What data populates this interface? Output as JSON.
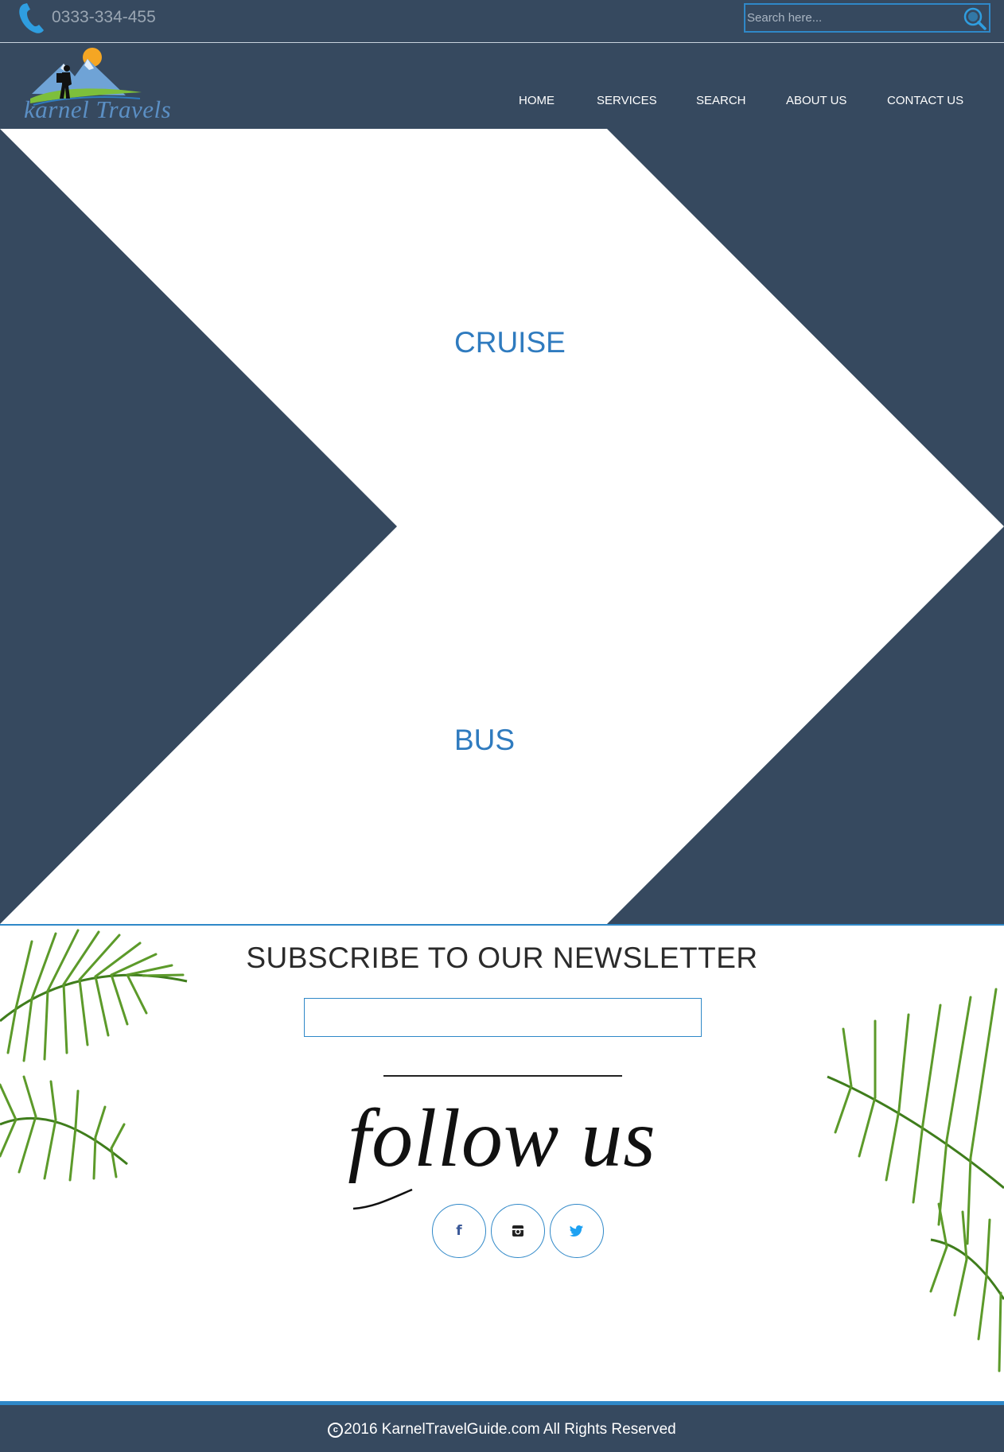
{
  "topbar": {
    "phone": "0333-334-455",
    "phone_icon": "phone-icon",
    "search_placeholder": "Search here...",
    "search_icon": "globe-search-icon"
  },
  "brand": {
    "logo_text": "karnel Travels"
  },
  "nav": {
    "items": [
      {
        "label": "HOME"
      },
      {
        "label": "SERVICES"
      },
      {
        "label": "SEARCH"
      },
      {
        "label": "ABOUT US"
      },
      {
        "label": "CONTACT US"
      }
    ]
  },
  "hero": {
    "labels": [
      "CRUISE",
      "BUS"
    ]
  },
  "newsletter": {
    "title": "SUBSCRIBE TO OUR NEWSLETTER",
    "input_value": ""
  },
  "follow": {
    "title": "follow us",
    "social": [
      {
        "icon": "facebook-icon",
        "glyph": "f"
      },
      {
        "icon": "instagram-icon"
      },
      {
        "icon": "twitter-icon"
      }
    ]
  },
  "footer": {
    "copy_symbol": "c",
    "text": "2016 KarnelTravelGuide.com All Rights Reserved"
  },
  "colors": {
    "navy": "#36495f",
    "accent_blue": "#2f88c8",
    "label_blue": "#2f7bbf",
    "white": "#ffffff"
  }
}
